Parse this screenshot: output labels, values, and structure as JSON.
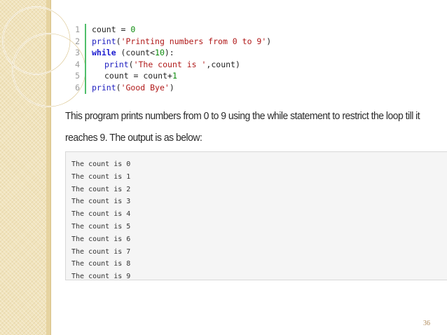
{
  "code": {
    "line_numbers": [
      "1",
      "2",
      "3",
      "4",
      "5",
      "6"
    ],
    "lines": [
      {
        "parts": [
          {
            "t": "count = ",
            "c": "code-text"
          },
          {
            "t": "0",
            "c": "num"
          }
        ]
      },
      {
        "parts": [
          {
            "t": "print",
            "c": "kw-fn"
          },
          {
            "t": "(",
            "c": "code-text"
          },
          {
            "t": "'Printing numbers from 0 to 9'",
            "c": "str"
          },
          {
            "t": ")",
            "c": "code-text"
          }
        ]
      },
      {
        "parts": [
          {
            "t": "while",
            "c": "kw"
          },
          {
            "t": " (count<",
            "c": "code-text"
          },
          {
            "t": "10",
            "c": "num"
          },
          {
            "t": "):",
            "c": "code-text"
          }
        ]
      },
      {
        "indent": true,
        "parts": [
          {
            "t": "print",
            "c": "kw-fn"
          },
          {
            "t": "(",
            "c": "code-text"
          },
          {
            "t": "'The count is '",
            "c": "str"
          },
          {
            "t": ",count)",
            "c": "code-text"
          }
        ]
      },
      {
        "indent": true,
        "parts": [
          {
            "t": "count = count+",
            "c": "code-text"
          },
          {
            "t": "1",
            "c": "num"
          }
        ]
      },
      {
        "parts": [
          {
            "t": "print",
            "c": "kw-fn"
          },
          {
            "t": "(",
            "c": "code-text"
          },
          {
            "t": "'Good Bye'",
            "c": "str"
          },
          {
            "t": ")",
            "c": "code-text"
          }
        ]
      }
    ]
  },
  "description": "This program prints numbers from 0 to 9 using the while statement to restrict the loop till it reaches 9. The output is as below:",
  "output": [
    "The count is 0",
    "The count is 1",
    "The count is 2",
    "The count is 3",
    "The count is 4",
    "The count is 5",
    "The count is 6",
    "The count is 7",
    "The count is 8",
    "The count is 9"
  ],
  "page_number": "36",
  "colors": {
    "gutter_line": "#4fbe6a",
    "band": "#f1e4bd",
    "keyword": "#1a1ad0",
    "string": "#b01818",
    "number": "#0a8a0a"
  }
}
